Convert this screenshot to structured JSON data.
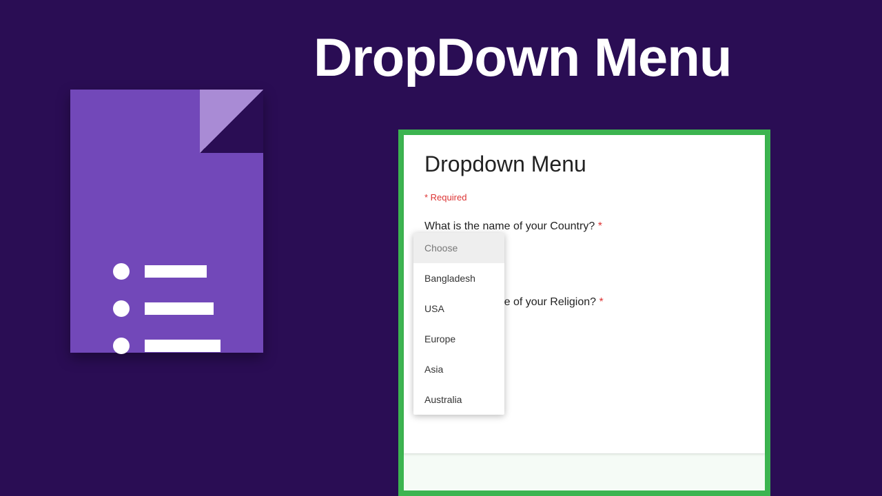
{
  "heading": "DropDown Menu",
  "form": {
    "title": "Dropdown Menu",
    "required_label": "* Required",
    "q1": {
      "label": "What is the name of your Country?",
      "star": "*"
    },
    "q2": {
      "label": "What is the name of your Religion?",
      "star": "*"
    }
  },
  "dropdown": {
    "placeholder": "Choose",
    "options": [
      "Bangladesh",
      "USA",
      "Europe",
      "Asia",
      "Australia"
    ]
  }
}
